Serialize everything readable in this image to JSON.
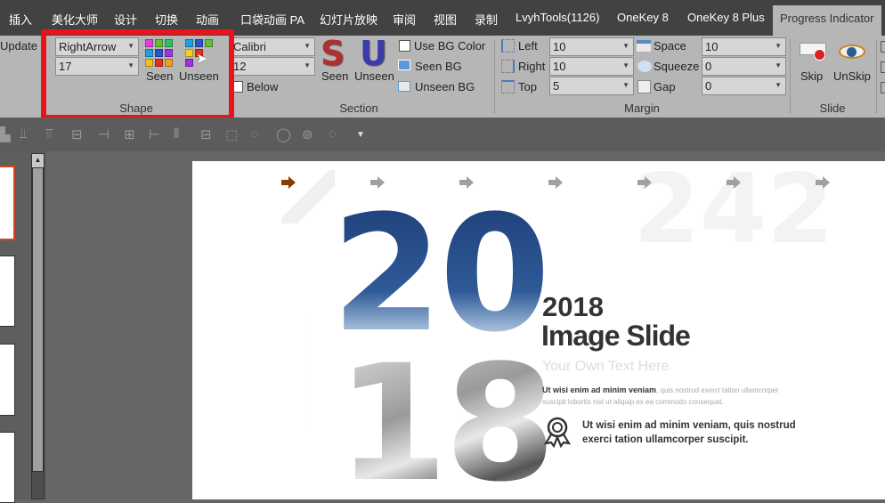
{
  "tabs": [
    "插入",
    "美化大师",
    "设计",
    "切换",
    "动画",
    "口袋动画 PA",
    "幻灯片放映",
    "审阅",
    "视图",
    "录制",
    "LvyhTools(1126)",
    "OneKey 8",
    "OneKey 8 Plus",
    "Progress Indicator"
  ],
  "active_tab": "Progress Indicator",
  "ribbon": {
    "update_label": "Update",
    "shape": {
      "shape_select": "RightArrow",
      "size_select": "17",
      "seen_label": "Seen",
      "unseen_label": "Unseen",
      "group_label": "Shape",
      "highlight_color": "#e8141c"
    },
    "section": {
      "font_select": "Calibri",
      "font_size_select": "12",
      "below_label": "Below",
      "seen_label": "Seen",
      "unseen_label": "Unseen",
      "use_bg_color_label": "Use BG Color",
      "seen_bg_label": "Seen BG",
      "unseen_bg_label": "Unseen BG",
      "group_label": "Section"
    },
    "margin": {
      "left_label": "Left",
      "left_value": "10",
      "right_label": "Right",
      "right_value": "10",
      "top_label": "Top",
      "top_value": "5",
      "space_label": "Space",
      "space_value": "10",
      "squeeze_label": "Squeeze",
      "squeeze_value": "0",
      "gap_label": "Gap",
      "gap_value": "0",
      "group_label": "Margin"
    },
    "slide": {
      "skip_label": "Skip",
      "unskip_label": "UnSkip",
      "group_label": "Slide"
    }
  },
  "slide": {
    "watermark": "242",
    "big_top": "20",
    "big_bottom": "18",
    "year": "2018",
    "title": "Image Slide",
    "subtitle": "Your Own Text Here",
    "para_bold": "Ut wisi enim ad minim veniam",
    "para_rest": ", quis nostrud exerci tation ullamcorper suscipit lobortis nisl ut aliquip ex ea commodo consequat.",
    "badge_text_1": "Ut wisi enim ad minim veniam, quis nostrud",
    "badge_text_2": "exerci tation ullamcorper suscipit.",
    "seen_arrow_color": "#8b3a0a",
    "unseen_arrow_color": "#a0a0a0",
    "seen_count": 1,
    "total_arrows": 7
  }
}
